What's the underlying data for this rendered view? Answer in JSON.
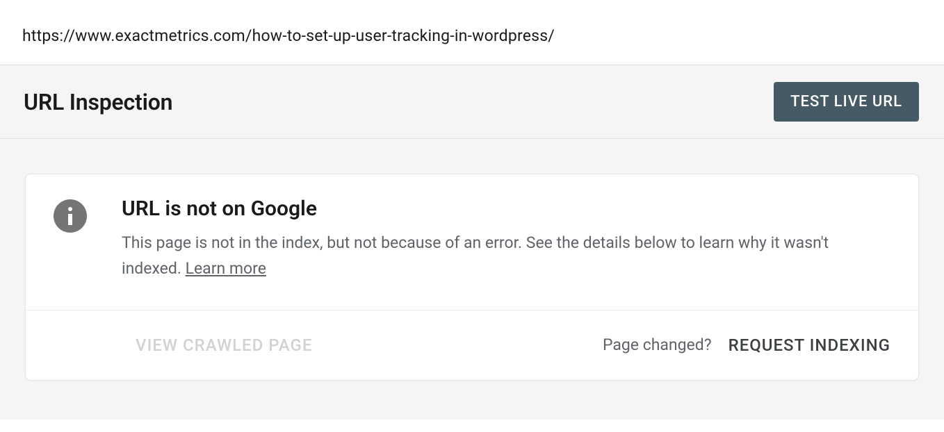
{
  "urlBar": {
    "url": "https://www.exactmetrics.com/how-to-set-up-user-tracking-in-wordpress/"
  },
  "toolbar": {
    "title": "URL Inspection",
    "testButton": "TEST LIVE URL"
  },
  "card": {
    "title": "URL is not on Google",
    "description": "This page is not in the index, but not because of an error. See the details below to learn why it wasn't indexed. ",
    "learnMore": "Learn more",
    "viewCrawled": "VIEW CRAWLED PAGE",
    "pageChanged": "Page changed?",
    "requestIndexing": "REQUEST INDEXING"
  }
}
